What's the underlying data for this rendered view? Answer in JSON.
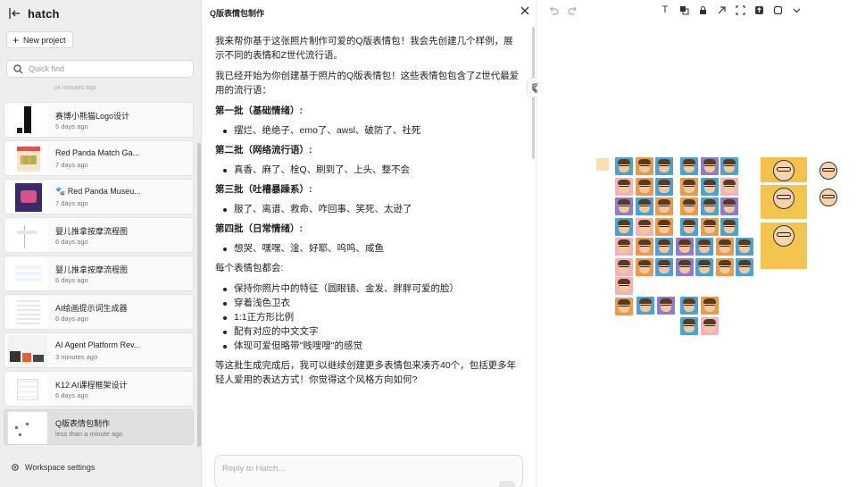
{
  "sidebar": {
    "brand": "hatch",
    "new_project_label": "New project",
    "search_placeholder": "Quick find",
    "ghost_time": "34 minutes ago",
    "projects": [
      {
        "title": "赛博小熊猫Logo设计",
        "time": "5 days ago"
      },
      {
        "title": "Red Panda Match Ga...",
        "time": "7 days ago"
      },
      {
        "title": "🐾 Red Panda Museu...",
        "time": "7 days ago"
      },
      {
        "title": "婴儿推拿按摩流程图",
        "time": "6 days ago"
      },
      {
        "title": "婴儿推拿按摩流程图",
        "time": "6 days ago"
      },
      {
        "title": "AI绘画提示词生成器",
        "time": "6 days ago"
      },
      {
        "title": "AI Agent Platform Rev...",
        "time": "3 minutes ago"
      },
      {
        "title": "K12 AI课程框架设计",
        "time": "6 days ago"
      },
      {
        "title": "Q版表情包制作",
        "time": "less than a minute ago"
      }
    ],
    "workspace_settings_label": "Workspace settings"
  },
  "chat": {
    "title": "Q版表情包制作",
    "intro1": "我来帮你基于这张照片制作可爱的Q版表情包！我会先创建几个样例，展示不同的表情和Z世代流行语。",
    "intro2": "我已经开始为你创建基于照片的Q版表情包！这些表情包包含了Z世代最爱用的流行语：",
    "batches": [
      {
        "heading": "第一批（基础情绪）:",
        "items": "摆烂、绝绝子、emo了、awsl、破防了、社死"
      },
      {
        "heading": "第二批（网络流行语）:",
        "items": "真香、麻了、栓Q、刷到了、上头、整不会"
      },
      {
        "heading": "第三批（吐槽暴躁系）:",
        "items": "服了、离谱、救命、咋回事、笑死、太逊了"
      },
      {
        "heading": "第四批（日常情绪）:",
        "items": "想哭、嘿嘿、淦、好耶、呜呜、咸鱼"
      }
    ],
    "features_intro": "每个表情包都会:",
    "features": [
      "保持你照片中的特征（圆眼镜、金发、胖胖可爱的脸）",
      "穿着浅色卫衣",
      "1:1正方形比例",
      "配有对应的中文文字",
      "体现可爱但略带\"贱嗖嗖\"的感觉"
    ],
    "outro": "等这批生成完成后，我可以继续创建更多表情包来凑齐40个，包括更多年轻人爱用的表达方式！你觉得这个风格方向如何?",
    "reply_placeholder": "Reply to Hatch..."
  },
  "canvas": {
    "colors": {
      "sticker_blue": "#4aa3d8",
      "sticker_orange": "#e89a4f",
      "sticker_pink": "#f1b3b9",
      "sticker_purple": "#8f7ad6",
      "sticker_yellow": "#f2c14e"
    },
    "big_sticker_colors": [
      "#f4c24a",
      "#f2c54f",
      "#f3c550"
    ]
  }
}
